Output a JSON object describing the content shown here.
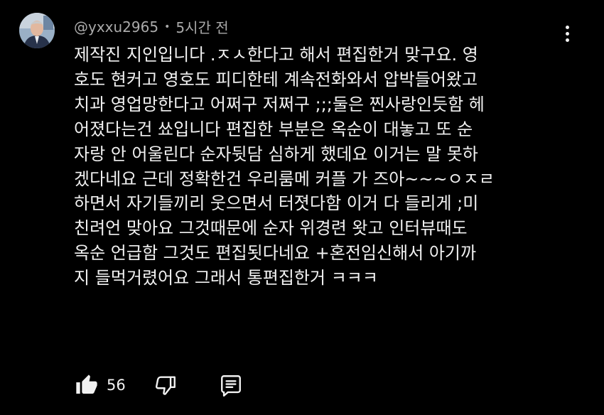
{
  "comment": {
    "author": "@yxxu2965",
    "separator": "•",
    "timestamp": "5시간 전",
    "lines": [
      "제작진 지인입니다 .ㅈㅅ한다고 해서 편집한거 맞구요. 영",
      "호도 현커고 영호도 피디한테 계속전화와서 압박들어왔고",
      "치과 영업망한다고 어쩌구 저쩌구 ;;;둘은 찐사랑인듯함 헤",
      "어졌다는건 쑈입니다 편집한 부분은 옥순이 대놓고 또 순",
      "자랑 안 어울린다 순자뒷담 심하게 했데요 이거는 말 못하",
      "겠다네요 근데 정확한건 우리룸메 커플 가 즈아~~~ㅇㅈㄹ",
      "하면서 자기들끼리 웃으면서 터졋다함 이거 다 들리게 ;미",
      "친려언 맞아요 그것때문에 순자 위경련 왓고 인터뷰때도",
      "옥순 언급함 그것도 편집됫다네요 +혼전임신해서 아기까",
      "지 들먹거렸어요 그래서 통편집한거 ㅋㅋㅋ"
    ],
    "like_count": "56"
  },
  "icons": {
    "more": "more-vert-icon",
    "like": "thumbs-up-icon",
    "dislike": "thumbs-down-icon",
    "reply": "comment-reply-icon"
  },
  "colors": {
    "background": "#000000",
    "text": "#f1f1f1",
    "secondary_text": "#aaaaaa"
  }
}
